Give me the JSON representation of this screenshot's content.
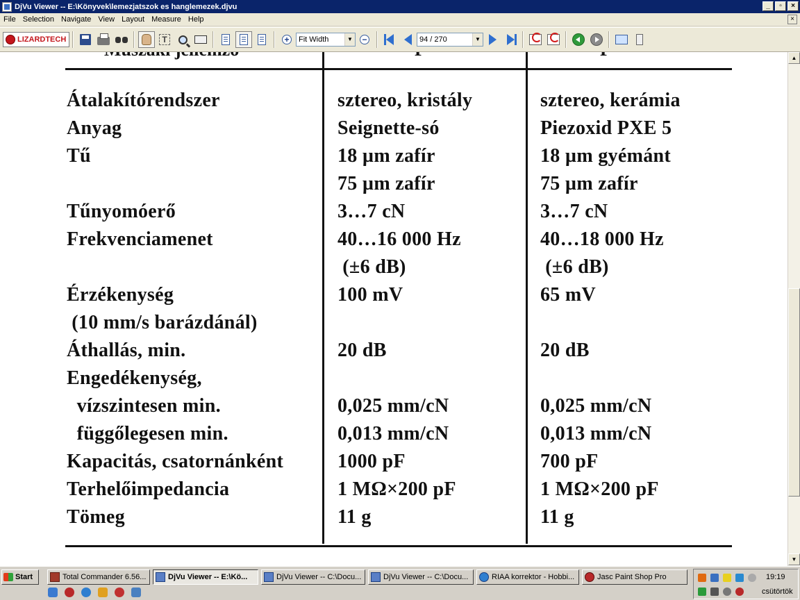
{
  "window": {
    "title": "DjVu Viewer -- E:\\Könyvek\\lemezjatszok es hanglemezek.djvu",
    "controls": [
      "_",
      "▫",
      "×"
    ]
  },
  "menu": [
    "File",
    "Selection",
    "Navigate",
    "View",
    "Layout",
    "Measure",
    "Help"
  ],
  "menu_close": "×",
  "toolbar": {
    "logo_text": "LIZARDTECH",
    "zoom_value": "Fit Width",
    "page_value": "94 / 270",
    "zoom_in_glyph": "+",
    "zoom_out_glyph": "−",
    "text_tool_glyph": "T"
  },
  "document": {
    "header_fragments": [
      "Műszaki jellemző",
      "P",
      "P"
    ],
    "rows": [
      [
        "Átalakítórendszer",
        "sztereo, kristály",
        "sztereo, kerámia"
      ],
      [
        "Anyag",
        "Seignette-só",
        "Piezoxid PXE 5"
      ],
      [
        "Tű",
        "18 µm zafír",
        "18 µm gyémánt"
      ],
      [
        "",
        "75 µm zafír",
        "75 µm zafír"
      ],
      [
        "Tűnyomóerő",
        "3…7 cN",
        "3…7 cN"
      ],
      [
        "Frekvenciamenet",
        "40…16 000 Hz",
        "40…18 000 Hz"
      ],
      [
        "",
        " (±6 dB)",
        " (±6 dB)"
      ],
      [
        "Érzékenység",
        "100 mV",
        "65 mV"
      ],
      [
        " (10 mm/s barázdánál)",
        "",
        ""
      ],
      [
        "Áthallás, min.",
        "20 dB",
        "20 dB"
      ],
      [
        "Engedékenység,",
        "",
        ""
      ],
      [
        "  vízszintesen min.",
        "0,025 mm/cN",
        "0,025 mm/cN"
      ],
      [
        "  függőlegesen min.",
        "0,013 mm/cN",
        "0,013 mm/cN"
      ],
      [
        "Kapacitás, csatornánként",
        "1000 pF",
        "700 pF"
      ],
      [
        "Terhelőimpedancia",
        "1 MΩ×200 pF",
        "1 MΩ×200 pF"
      ],
      [
        "Tömeg",
        "11 g",
        "11 g"
      ]
    ]
  },
  "scrollbar": {
    "up": "▲",
    "down": "▼"
  },
  "taskbar": {
    "start_label": "Start",
    "tasks": [
      {
        "label": "Total Commander 6.56...",
        "icon": "tc"
      },
      {
        "label": "DjVu Viewer -- E:\\Kö...",
        "icon": "djvu",
        "active": true
      },
      {
        "label": "DjVu Viewer -- C:\\Docu...",
        "icon": "djvu"
      },
      {
        "label": "DjVu Viewer -- C:\\Docu...",
        "icon": "djvu"
      },
      {
        "label": "RIAA korrektor - Hobbi...",
        "icon": "ie"
      },
      {
        "label": "Jasc Paint Shop Pro",
        "icon": "psp"
      }
    ],
    "clock_time": "19:19",
    "clock_day": "csütörtök"
  },
  "colors": {
    "titlebar": "#0a246a",
    "chrome": "#ece9d8",
    "taskbar": "#d4d0c8",
    "logo_red": "#c4161c"
  }
}
